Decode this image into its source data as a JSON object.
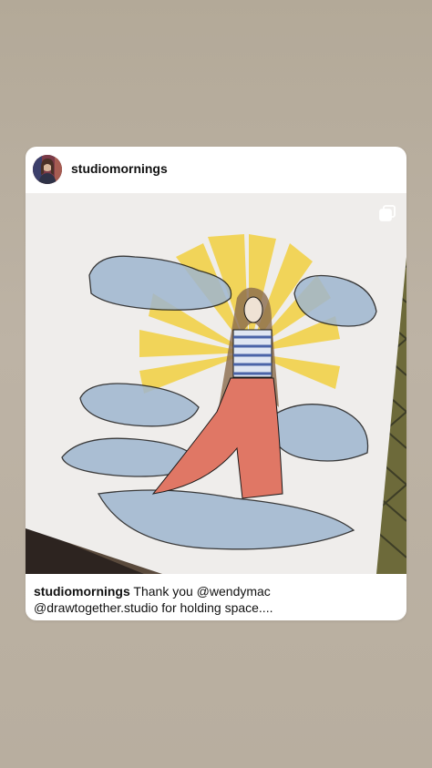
{
  "post": {
    "username": "studiomornings",
    "caption": {
      "username": "studiomornings",
      "text_line1": " Thank you @wendymac",
      "text_line2": "@drawtogether.studio for holding space...."
    }
  },
  "icons": {
    "avatar": "profile-avatar",
    "multi_photo": "multiple-photos-icon"
  },
  "colors": {
    "background": "#b8ad9f",
    "card": "#ffffff",
    "text": "#111111"
  }
}
